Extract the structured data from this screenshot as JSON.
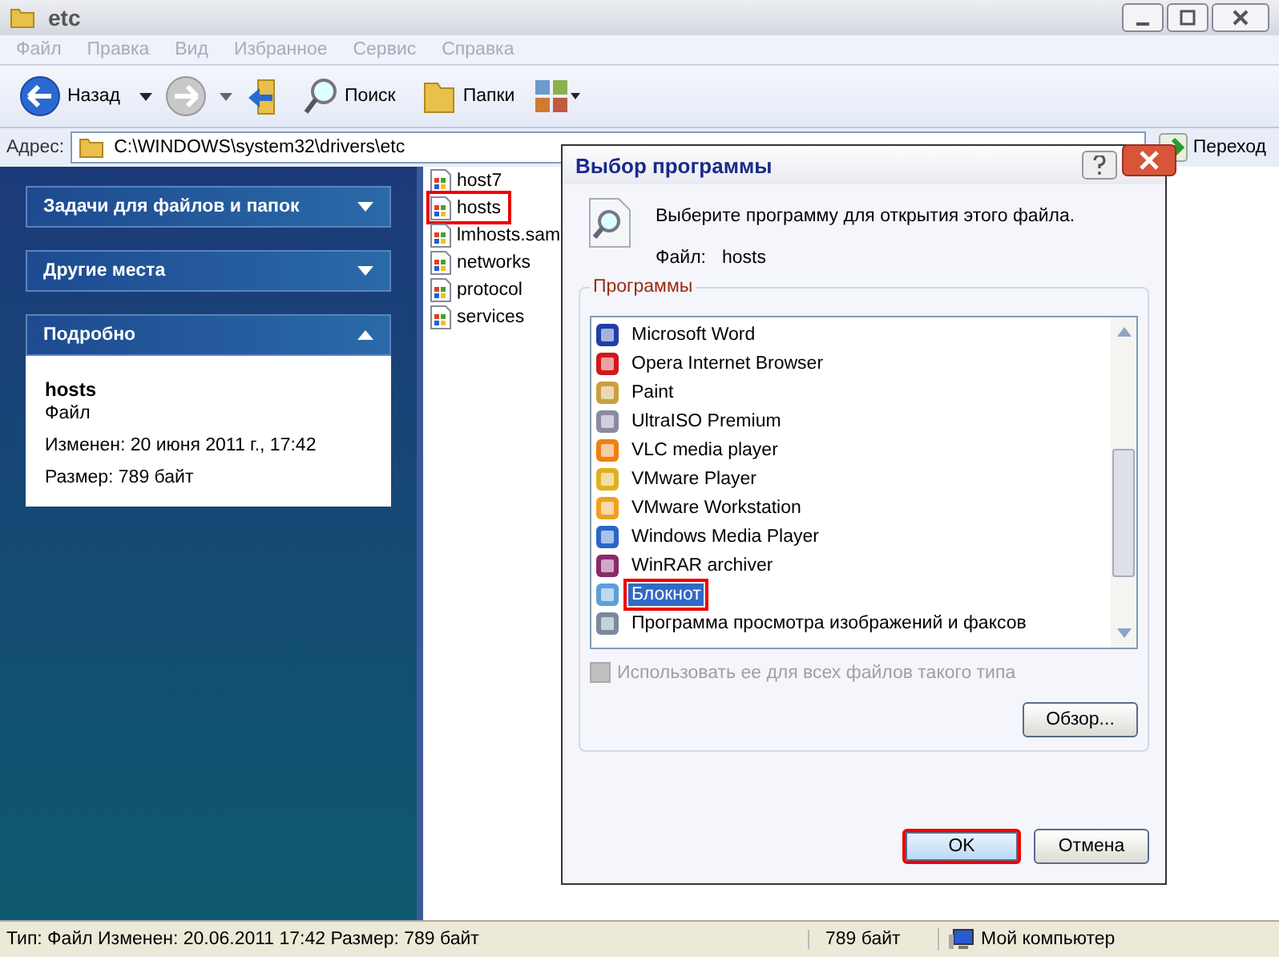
{
  "window": {
    "title": "etc"
  },
  "menu": [
    "Файл",
    "Правка",
    "Вид",
    "Избранное",
    "Сервис",
    "Справка"
  ],
  "toolbar": {
    "back": "Назад",
    "search": "Поиск",
    "folders": "Папки"
  },
  "address": {
    "label": "Адрес:",
    "value": "C:\\WINDOWS\\system32\\drivers\\etc",
    "go": "Переход"
  },
  "sidebar": {
    "sections": [
      {
        "title": "Задачи для файлов и папок",
        "expanded": false
      },
      {
        "title": "Другие места",
        "expanded": false
      },
      {
        "title": "Подробно",
        "expanded": true,
        "name": "hosts",
        "type": "Файл",
        "modified": "Изменен: 20 июня 2011 г., 17:42",
        "size": "Размер: 789 байт"
      }
    ]
  },
  "files": [
    {
      "name": "host7",
      "highlighted": false
    },
    {
      "name": "hosts",
      "highlighted": true
    },
    {
      "name": "lmhosts.sam",
      "highlighted": false
    },
    {
      "name": "networks",
      "highlighted": false
    },
    {
      "name": "protocol",
      "highlighted": false
    },
    {
      "name": "services",
      "highlighted": false
    }
  ],
  "dialog": {
    "title": "Выбор программы",
    "prompt": "Выберите программу для открытия этого файла.",
    "file_label": "Файл:",
    "file_name": "hosts",
    "group": "Программы",
    "programs": [
      {
        "name": "Microsoft Word",
        "selected": false
      },
      {
        "name": "Opera Internet Browser",
        "selected": false
      },
      {
        "name": "Paint",
        "selected": false
      },
      {
        "name": "UltraISO Premium",
        "selected": false
      },
      {
        "name": "VLC media player",
        "selected": false
      },
      {
        "name": "VMware Player",
        "selected": false
      },
      {
        "name": "VMware Workstation",
        "selected": false
      },
      {
        "name": "Windows Media Player",
        "selected": false
      },
      {
        "name": "WinRAR archiver",
        "selected": false
      },
      {
        "name": "Блокнот",
        "selected": true
      },
      {
        "name": "Программа просмотра изображений и факсов",
        "selected": false
      }
    ],
    "always": {
      "label": "Использовать ее для всех файлов такого типа",
      "checked": false,
      "disabled": true
    },
    "browse": "Обзор...",
    "ok": {
      "label": "OK",
      "highlighted": true
    },
    "cancel": "Отмена"
  },
  "status_bar": {
    "info": "Тип: Файл Изменен: 20.06.2011 17:42 Размер: 789 байт",
    "size": "789 байт",
    "zone": "Мой компьютер"
  }
}
